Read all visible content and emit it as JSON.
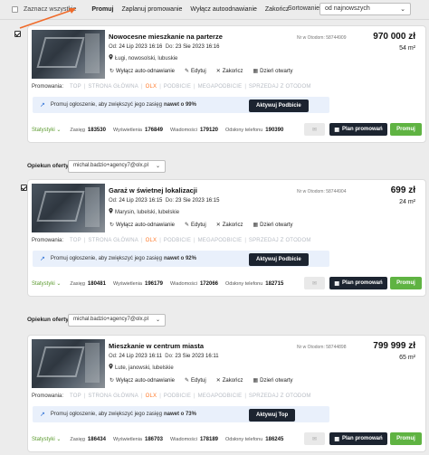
{
  "topbar": {
    "select_all": "Zaznacz wszystkie",
    "promuj": "Promuj",
    "zaplanuj": "Zaplanuj promowanie",
    "wylacz": "Wyłącz autoodnawianie",
    "zakoncz": "Zakończ",
    "sort_label": "Sortowanie",
    "sort_value": "od najnowszych"
  },
  "labels": {
    "od": "Od:",
    "do": "Do:",
    "promowania": "Promowania:",
    "statystyki": "Statystyki",
    "zasieg": "Zasięg",
    "wyswietlenia": "Wyświetlenia",
    "wiadomosci": "Wiadomości",
    "odslony": "Odsłony telefonu",
    "wylacz_auto": "Wyłącz auto-odnawianie",
    "edytuj": "Edytuj",
    "zakoncz": "Zakończ",
    "dzien": "Dzień otwarty",
    "plan": "Plan promowań",
    "promuj": "Promuj",
    "opiekun": "Opiekun oferty",
    "banner_pre": "Promuj ogłoszenie, aby zwiększyć jego zasięg",
    "m2_unit": "m²"
  },
  "promo_options": [
    "TOP",
    "STRONA GŁÓWNA",
    "OLX",
    "PODBICIE",
    "MEGAPODBICIE",
    "SPRZEDAJ Z OTODOM"
  ],
  "opiekun_value": "michal.badzio+agency7@olx.pl",
  "listings": [
    {
      "title": "Nowocesne mieszkanie na parterze",
      "date_from": "24 Lip 2023 16:16",
      "date_to": "23 Sie 2023 16:16",
      "location": "Ługi, nowosolski, lubuskie",
      "otodom": "Nr w Otodom: 58744909",
      "price": "970 000 zł",
      "area": "54 m²",
      "banner_strong": "nawet o 99%",
      "banner_button": "Aktywuj Podbicie",
      "zasieg": "183530",
      "wyswietlenia": "176849",
      "wiadomosci": "179120",
      "odslony": "190390"
    },
    {
      "title": "Garaż w świetnej lokalizacji",
      "date_from": "24 Lip 2023 16:15",
      "date_to": "23 Sie 2023 16:15",
      "location": "Marysin, lubelski, lubelskie",
      "otodom": "Nr w Otodom: 58744904",
      "price": "699 zł",
      "area": "24 m²",
      "banner_strong": "nawet o 92%",
      "banner_button": "Aktywuj Podbicie",
      "zasieg": "180481",
      "wyswietlenia": "196179",
      "wiadomosci": "172066",
      "odslony": "182715"
    },
    {
      "title": "Mieszkanie w centrum miasta",
      "date_from": "24 Lip 2023 16:11",
      "date_to": "23 Sie 2023 16:11",
      "location": "Lute, janowski, lubelskie",
      "otodom": "Nr w Otodom: 58744898",
      "price": "799 999 zł",
      "area": "65 m²",
      "banner_strong": "nawet o 73%",
      "banner_button": "Aktywuj Top",
      "zasieg": "186434",
      "wyswietlenia": "186703",
      "wiadomosci": "178189",
      "odslony": "186245"
    }
  ]
}
